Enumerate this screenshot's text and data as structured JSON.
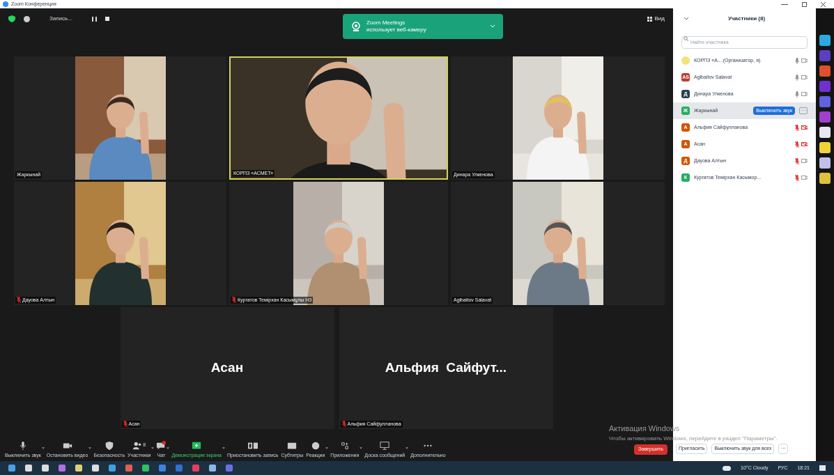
{
  "window": {
    "title": "Zoom Конференция"
  },
  "top_bar": {
    "recording": "Запись...",
    "view": "Вид"
  },
  "notification": {
    "title": "Zoom Meetings",
    "text": "использует веб-камеру"
  },
  "tiles": [
    {
      "name": "Жаркынай",
      "muted": false,
      "video": true,
      "speaking": false
    },
    {
      "name": "КОРПЗ «АСМЕТ»",
      "muted": false,
      "video": true,
      "speaking": true
    },
    {
      "name": "Динара Улкенова",
      "muted": false,
      "video": true,
      "speaking": false
    },
    {
      "name": "Дауова Алтын",
      "muted": true,
      "video": true,
      "speaking": false
    },
    {
      "name": "Кургатов Темірхан Касымұлы НЗ",
      "muted": true,
      "video": true,
      "speaking": false
    },
    {
      "name": "Agibaitov Salavat",
      "muted": false,
      "video": true,
      "speaking": false
    },
    {
      "name": "Асан",
      "display_name": "Асан",
      "muted": true,
      "video": false,
      "speaking": false
    },
    {
      "name": "Альфия Сайфулланова",
      "display_name": "Альфия  Сайфут...",
      "muted": true,
      "video": false,
      "speaking": false
    }
  ],
  "toolbar": [
    {
      "kind": "mic",
      "label": "Выключить звук"
    },
    {
      "kind": "camera",
      "label": "Остановить видео"
    },
    {
      "kind": "shield",
      "label": "Безопасность"
    },
    {
      "kind": "people",
      "label": "Участники",
      "count": "8"
    },
    {
      "kind": "chat",
      "label": "Чат"
    },
    {
      "kind": "share",
      "label": "Демонстрация экрана"
    },
    {
      "kind": "record",
      "label": "Приостановить запись"
    },
    {
      "kind": "cc",
      "label": "Субтитры"
    },
    {
      "kind": "emoji",
      "label": "Реакции"
    },
    {
      "kind": "apps",
      "label": "Приложения"
    },
    {
      "kind": "board",
      "label": "Доска сообщений"
    },
    {
      "kind": "more",
      "label": "Дополнительно"
    }
  ],
  "end_button": "Завершить",
  "activation": {
    "title": "Активация Windows",
    "text": "Чтобы активировать Windows, перейдите в раздел \"Параметры\"."
  },
  "participants_panel": {
    "title": "Участники (8)",
    "search_placeholder": "Найти участника",
    "items": [
      {
        "color": "#f3e27a",
        "name": "КОРПЗ «А... (Организатор, я)",
        "muted": false,
        "video_on": true,
        "selected": false
      },
      {
        "initials": "AS",
        "color": "#c0392b",
        "name": "Agibaitov Salavat",
        "muted": false,
        "video_on": true,
        "selected": false
      },
      {
        "initials": "Д",
        "color": "#2c3e50",
        "name": "Динара Улкенова",
        "muted": false,
        "video_on": true,
        "selected": false
      },
      {
        "initials": "Ж",
        "color": "#27ae60",
        "name": "Жаркынай",
        "selected": true,
        "action": "Выключить звук"
      },
      {
        "initials": "А",
        "color": "#d35400",
        "name": "Альфия Сайфулланова",
        "muted": true,
        "video_on": false,
        "selected": false
      },
      {
        "initials": "А",
        "color": "#d35400",
        "name": "Асан",
        "muted": true,
        "video_on": false,
        "selected": false
      },
      {
        "initials": "Д",
        "color": "#d35400",
        "name": "Дауова Алтын",
        "muted": true,
        "video_on": true,
        "selected": false
      },
      {
        "initials": "К",
        "color": "#27ae60",
        "name": "Кургатов Темірхан Касымор...",
        "muted": true,
        "video_on": true,
        "selected": false
      }
    ],
    "buttons": [
      "Пригласить",
      "Выключить звук для всех"
    ],
    "more": "···"
  },
  "taskbar": {
    "weather": "10°C Cloudy",
    "language": "РУС",
    "time": "18:21"
  }
}
